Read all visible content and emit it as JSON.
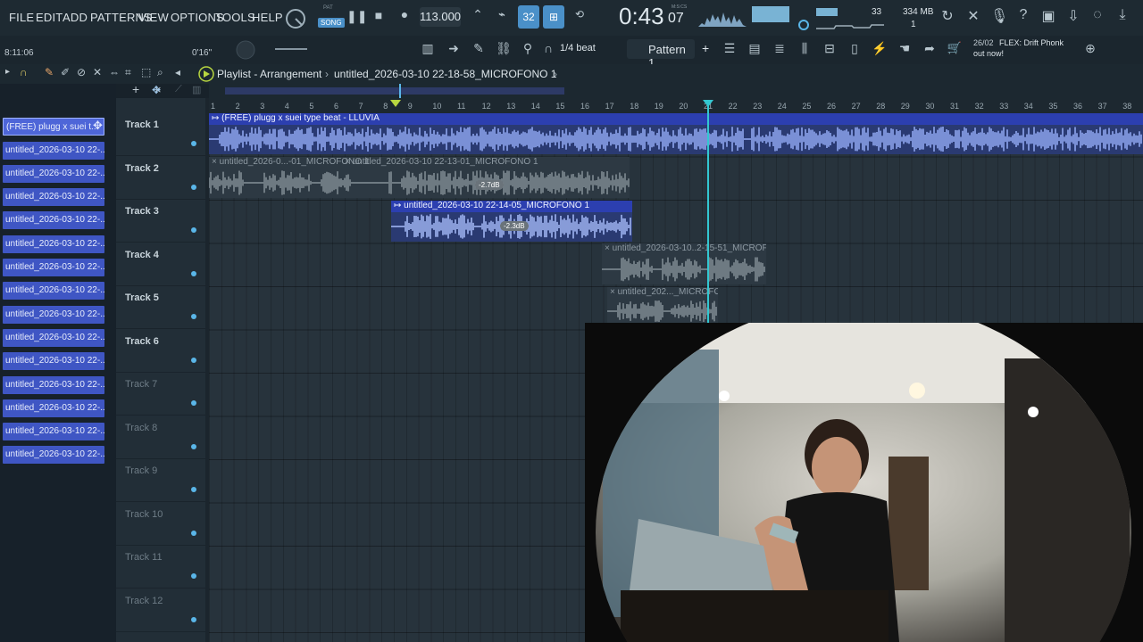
{
  "menu": [
    "FILE",
    "EDIT",
    "ADD",
    "PATTERNS",
    "VIEW",
    "OPTIONS",
    "TOOLS",
    "HELP"
  ],
  "transport": {
    "pat_label": "PAT",
    "song_label": "SONG",
    "tempo": "113.000",
    "time_main": "0:43",
    "time_sub": "07",
    "time_unit": "M:S:CS",
    "cpu_value": "33",
    "memory": "334 MB",
    "voices": "1",
    "step_label": "32"
  },
  "hint_bar": {
    "left_time": "8:11:06",
    "mid_time": "0'16\""
  },
  "toolbar2": {
    "snap": "1/4 beat",
    "pattern": "Pattern 1",
    "plus": "+",
    "news_date": "26/02",
    "news_line1": "FLEX: Drift Phonk",
    "news_line2": "out now!"
  },
  "playlist": {
    "title": "Playlist - Arrangement",
    "separator": "›",
    "breadcrumb": "untitled_2026-03-10 22-18-58_MICROFONO 1",
    "tail": "›"
  },
  "clip_list": [
    "(FREE) plugg x suei t...",
    "untitled_2026-03-10 22-...",
    "untitled_2026-03-10 22-...",
    "untitled_2026-03-10 22-...",
    "untitled_2026-03-10 22-...",
    "untitled_2026-03-10 22-...",
    "untitled_2026-03-10 22-...",
    "untitled_2026-03-10 22-...",
    "untitled_2026-03-10 22-...",
    "untitled_2026-03-10 22-...",
    "untitled_2026-03-10 22-...",
    "untitled_2026-03-10 22-...",
    "untitled_2026-03-10 22-...",
    "untitled_2026-03-10 22-...",
    "untitled_2026-03-10 22-..."
  ],
  "tracks": [
    "Track 1",
    "Track 2",
    "Track 3",
    "Track 4",
    "Track 5",
    "Track 6",
    "Track 7",
    "Track 8",
    "Track 9",
    "Track 10",
    "Track 11",
    "Track 12"
  ],
  "ruler": [
    "1",
    "2",
    "3",
    "4",
    "5",
    "6",
    "7",
    "8",
    "9",
    "10",
    "11",
    "12",
    "13",
    "14",
    "15",
    "16",
    "17",
    "18",
    "19",
    "20",
    "21",
    "22",
    "23",
    "24",
    "25",
    "26",
    "27",
    "28",
    "29",
    "30",
    "31",
    "32",
    "33",
    "34",
    "35",
    "36",
    "37",
    "38"
  ],
  "clips": {
    "beat": "↦ (FREE) plugg x suei type beat - LLUVIA",
    "t2a": "× untitled_2026-0...-01_MICROFONO 1",
    "t2b": "× untitled_2026-03-10 22-13-01_MICROFONO 1",
    "t2_vol": "-2.7dB",
    "t3": "↦ untitled_2026-03-10 22-14-05_MICROFONO 1",
    "t3_vol": "-2.3dB",
    "t4": "× untitled_2026-03-10..2-15-51_MICROFONO 1",
    "t5": "× untitled_202..._MICROFONO 1"
  },
  "colors": {
    "accent": "#4a90c8",
    "clip_blue": "#2c3fb0",
    "playhead": "#33c7d1"
  }
}
